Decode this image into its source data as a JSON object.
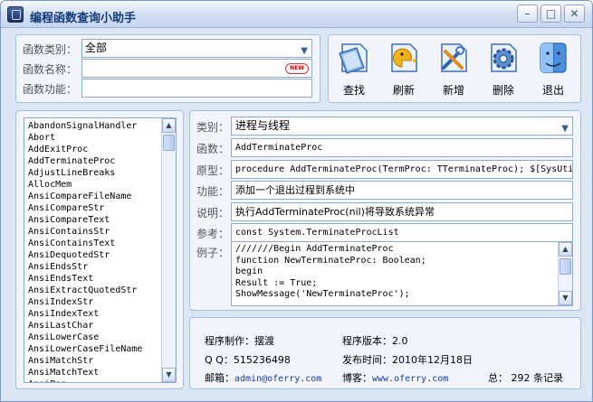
{
  "window": {
    "title": "编程函数查询小助手",
    "minimize_glyph": "–",
    "maximize_glyph": "□",
    "close_glyph": "✕"
  },
  "search": {
    "category_label": "函数类别：",
    "category_value": "全部",
    "name_label": "函数名称：",
    "name_value": "",
    "new_badge": "NEW",
    "function_label": "函数功能：",
    "function_value": ""
  },
  "toolbar": [
    {
      "label": "查找",
      "icon": "document-search-icon"
    },
    {
      "label": "刷新",
      "icon": "refresh-pacman-icon"
    },
    {
      "label": "新增",
      "icon": "add-tools-icon"
    },
    {
      "label": "删除",
      "icon": "delete-gear-icon"
    },
    {
      "label": "退出",
      "icon": "exit-mac-icon"
    }
  ],
  "function_list": [
    "AbandonSignalHandler",
    "Abort",
    "AddExitProc",
    "AddTerminateProc",
    "AdjustLineBreaks",
    "AllocMem",
    "AnsiCompareFileName",
    "AnsiCompareStr",
    "AnsiCompareText",
    "AnsiContainsStr",
    "AnsiContainsText",
    "AnsiDequotedStr",
    "AnsiEndsStr",
    "AnsiEndsText",
    "AnsiExtractQuotedStr",
    "AnsiIndexStr",
    "AnsiIndexText",
    "AnsiLastChar",
    "AnsiLowerCase",
    "AnsiLowerCaseFileName",
    "AnsiMatchStr",
    "AnsiMatchText",
    "AnsiPos"
  ],
  "detail": {
    "category_label": "类别：",
    "category_value": "进程与线程",
    "function_label": "函数：",
    "function_value": "AddTerminateProc",
    "prototype_label": "原型：",
    "prototype_value": "procedure AddTerminateProc(TermProc: TTerminateProc); $[SysUti",
    "feature_label": "功能：",
    "feature_value": "添加一个退出过程到系统中",
    "note_label": "说明：",
    "note_value": "执行AddTerminateProc(nil)将导致系统异常",
    "ref_label": "参考：",
    "ref_value": "const System.TerminateProcList",
    "example_label": "例子：",
    "example_code": "///////Begin AddTerminateProc\nfunction NewTerminateProc: Boolean;\nbegin\nResult := True;\nShowMessage('NewTerminateProc');"
  },
  "info": {
    "author_label": "程序制作：",
    "author_value": "摆渡",
    "version_label": "程序版本：",
    "version_value": "2.0",
    "qq_label": "Q Q：",
    "qq_value": "515236498",
    "date_label": "发布时间：",
    "date_value": "2010年12月18日",
    "email_label": "邮箱：",
    "email_value": "admin@oferry.com",
    "blog_label": "博客：",
    "blog_value": "www.oferry.com",
    "total_label": "总：",
    "total_count": "292",
    "total_unit": "条记录"
  }
}
